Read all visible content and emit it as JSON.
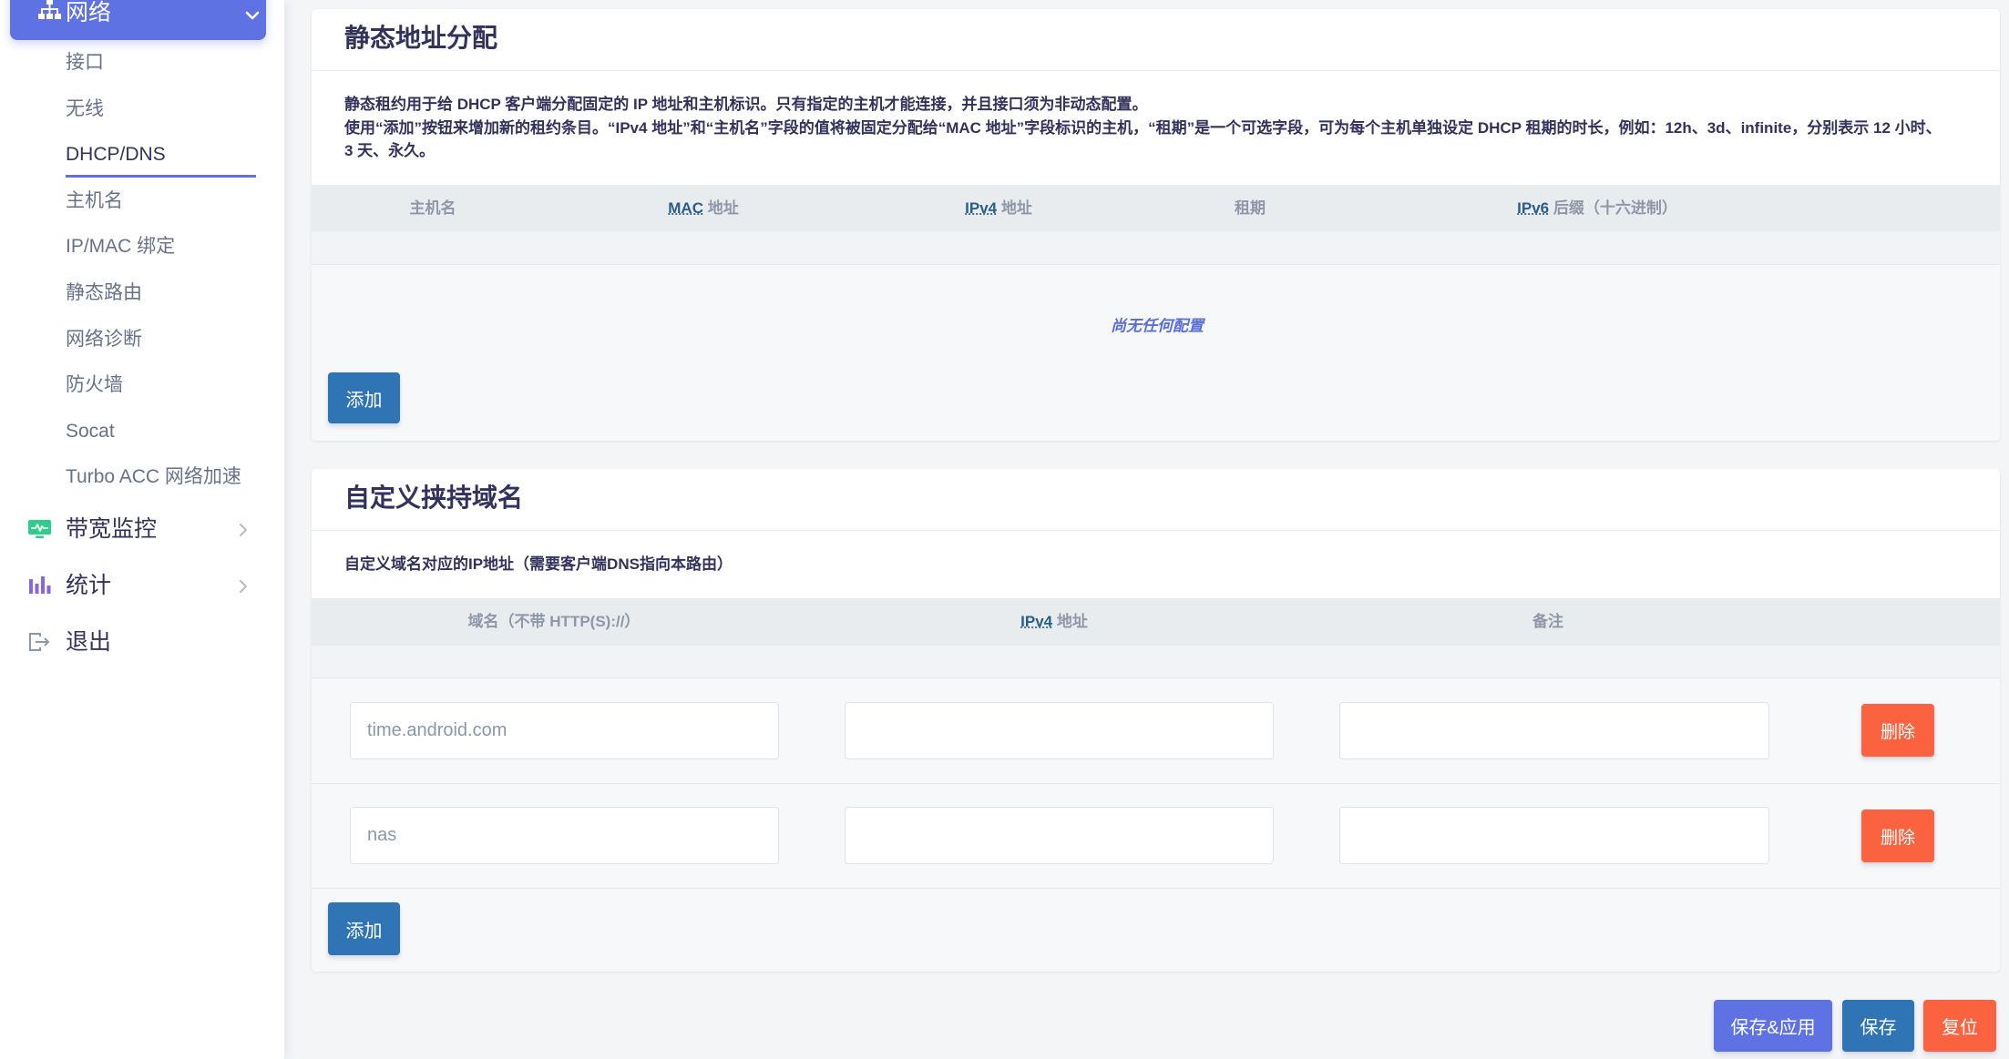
{
  "sidebar": {
    "active_section": {
      "label": "网络",
      "icon": "sitemap-icon"
    },
    "submenu": [
      {
        "label": "接口"
      },
      {
        "label": "无线"
      },
      {
        "label": "DHCP/DNS",
        "active": true
      },
      {
        "label": "主机名"
      },
      {
        "label": "IP/MAC 绑定"
      },
      {
        "label": "静态路由"
      },
      {
        "label": "网络诊断"
      },
      {
        "label": "防火墙"
      },
      {
        "label": "Socat"
      },
      {
        "label": "Turbo ACC 网络加速"
      }
    ],
    "sections": [
      {
        "label": "带宽监控",
        "icon": "monitor-icon",
        "color": "#2dce89"
      },
      {
        "label": "统计",
        "icon": "bar-chart-icon",
        "color": "#8965e0"
      },
      {
        "label": "退出",
        "icon": "logout-icon",
        "color": "#8898aa"
      }
    ]
  },
  "static_leases": {
    "title": "静态地址分配",
    "description": [
      "静态租约用于给 DHCP 客户端分配固定的 IP 地址和主机标识。只有指定的主机才能连接，并且接口须为非动态配置。",
      "使用“添加”按钮来增加新的租约条目。“IPv4 地址”和“主机名”字段的值将被固定分配给“MAC 地址”字段标识的主机，“租期”是一个可选字段，可为每个主机单独设定 DHCP 租期的时长，例如：12h、3d、infinite，分别表示 12 小时、3 天、永久。"
    ],
    "columns": [
      {
        "text": "主机名"
      },
      {
        "abbr": "MAC",
        "text": "地址"
      },
      {
        "abbr": "IPv4",
        "text": "地址"
      },
      {
        "text": "租期"
      },
      {
        "abbr": "IPv6",
        "text": "后缀（十六进制）"
      }
    ],
    "empty_text": "尚无任何配置",
    "add_label": "添加"
  },
  "custom_domains": {
    "title": "自定义挟持域名",
    "description": "自定义域名对应的IP地址（需要客户端DNS指向本路由）",
    "columns": [
      {
        "text": "域名（不带 HTTP(S)://）"
      },
      {
        "abbr": "IPv4",
        "text": "地址"
      },
      {
        "text": "备注"
      }
    ],
    "rows": [
      {
        "domain": "time.android.com",
        "ipv4": "",
        "note": "",
        "delete_label": "删除"
      },
      {
        "domain": "nas",
        "ipv4": "",
        "note": "",
        "delete_label": "删除"
      }
    ],
    "add_label": "添加"
  },
  "footer": {
    "save_apply_label": "保存&应用",
    "save_label": "保存",
    "reset_label": "复位"
  },
  "colors": {
    "accent": "#5e72e4",
    "primary": "#2f75b5",
    "danger": "#fb6340",
    "text": "#32325d"
  }
}
